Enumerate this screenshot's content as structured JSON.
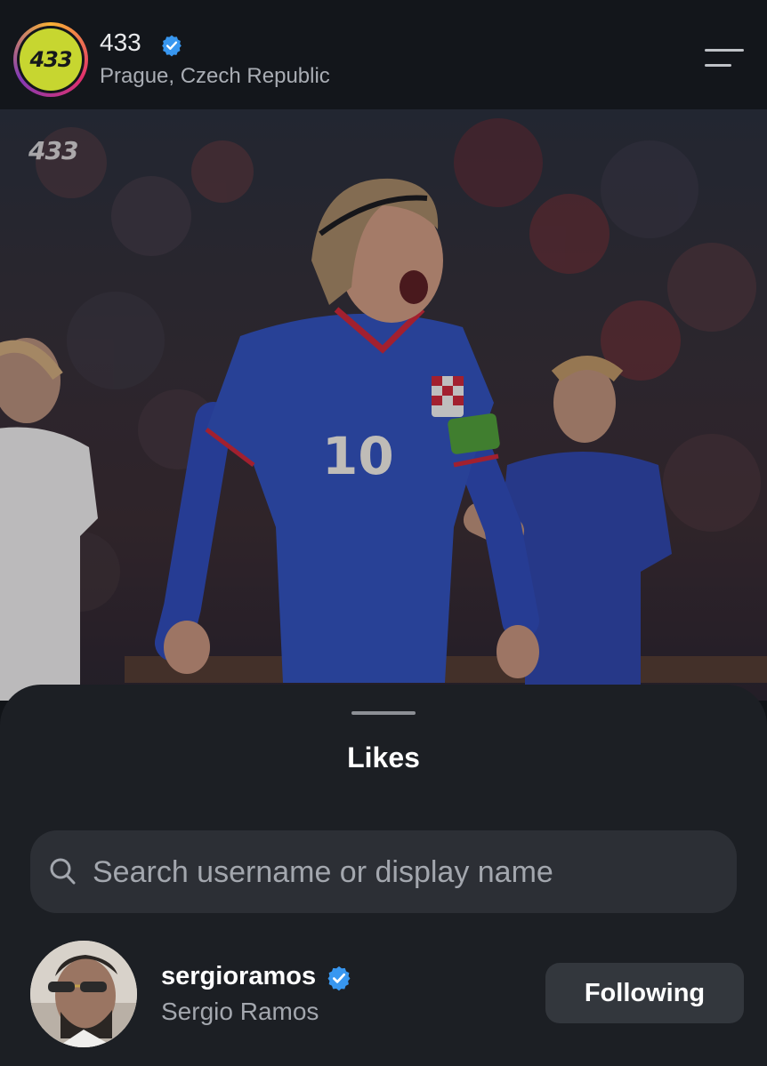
{
  "header": {
    "avatar_text": "433",
    "account_name": "433",
    "location": "Prague, Czech Republic",
    "verified_icon": "verified-badge-icon",
    "menu_icon": "menu-icon"
  },
  "post": {
    "watermark": "433",
    "jersey_number": "10"
  },
  "likes_sheet": {
    "title": "Likes",
    "search": {
      "placeholder": "Search username or display name",
      "value": ""
    },
    "users": [
      {
        "username": "sergioramos",
        "display_name": "Sergio Ramos",
        "verified": true,
        "button_label": "Following"
      }
    ]
  },
  "colors": {
    "background": "#111418",
    "sheet": "#1c1f24",
    "search_field": "#2c2f35",
    "button": "#33373d",
    "verified": "#3897f0",
    "avatar_logo": "#c7d630"
  }
}
